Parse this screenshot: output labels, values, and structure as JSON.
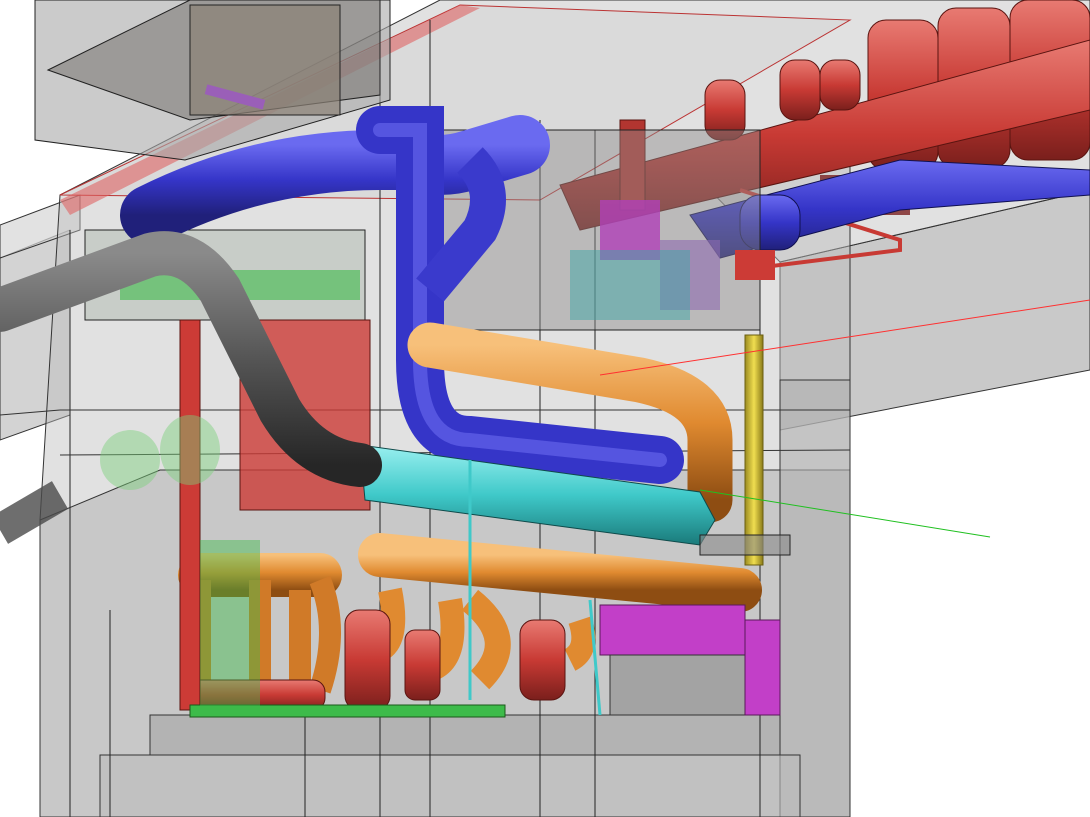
{
  "scene": {
    "description_visible_text": [],
    "colors": {
      "background": "#ffffff",
      "concrete_fill": "#bfbfbf",
      "concrete_edge": "#3a3a3a",
      "supply_blue": "#3a3acc",
      "return_red": "#cc3b36",
      "chilled_orange": "#e08a30",
      "condenser_cyan": "#3fc9c9",
      "exhaust_gray": "#555555",
      "yellow_pipe": "#e2cc3a",
      "green_equipment": "#3dbb4a",
      "magenta_panel": "#c23fc8",
      "axis_red": "#ff3030",
      "axis_green": "#20c020"
    },
    "systems": [
      {
        "name": "supply-duct",
        "color_key": "supply_blue"
      },
      {
        "name": "hot-water-header",
        "color_key": "return_red"
      },
      {
        "name": "chilled-water-pipe",
        "color_key": "chilled_orange"
      },
      {
        "name": "condenser-duct",
        "color_key": "condenser_cyan"
      },
      {
        "name": "flue-pipe",
        "color_key": "exhaust_gray"
      },
      {
        "name": "riser-pipe",
        "color_key": "yellow_pipe"
      }
    ]
  }
}
